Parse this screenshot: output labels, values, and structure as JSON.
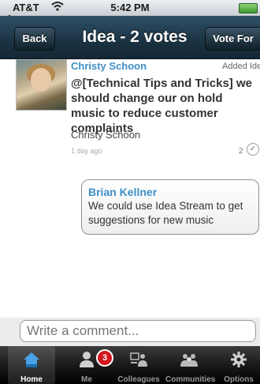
{
  "status_bar": {
    "carrier": "AT&T",
    "time": "5:42 PM"
  },
  "nav": {
    "back_label": "Back",
    "title": "Idea - 2 votes",
    "vote_label": "Vote For"
  },
  "idea": {
    "author": "Christy Schoon",
    "added_label": "Added Idea",
    "text": "@[Technical Tips and Tricks] we should change our on hold music to reduce customer complaints",
    "byline": "Christy Schoon",
    "time_ago": "1 day ago",
    "vote_count": "2"
  },
  "comments": [
    {
      "author": "Brian Kellner",
      "text": "We could use Idea Stream to get suggestions for new music"
    }
  ],
  "comment_input": {
    "placeholder": "Write a comment..."
  },
  "tabs": [
    {
      "label": "Home"
    },
    {
      "label": "Me",
      "badge": "3"
    },
    {
      "label": "Colleagues"
    },
    {
      "label": "Communities"
    },
    {
      "label": "Options"
    }
  ],
  "colors": {
    "link_blue": "#3f8fc7",
    "nav_dark": "#1b3342",
    "badge_red": "#d2161c"
  },
  "icons": [
    "signal-icon",
    "wifi-icon",
    "battery-icon",
    "home-icon",
    "me-icon",
    "colleagues-icon",
    "communities-icon",
    "options-icon",
    "checkmark-icon"
  ]
}
